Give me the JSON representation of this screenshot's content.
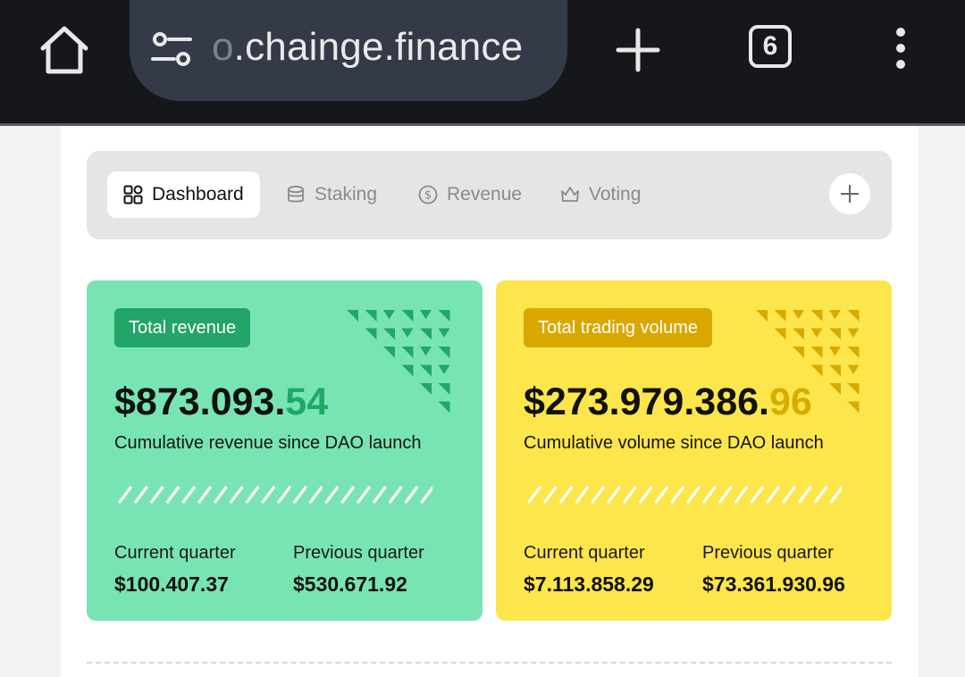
{
  "browser": {
    "url_faded": "o",
    "url_main": ".chainge.finance",
    "tab_count": "6"
  },
  "tabs": [
    {
      "label": "Dashboard",
      "icon": "grid-icon",
      "active": true
    },
    {
      "label": "Staking",
      "icon": "database-icon",
      "active": false
    },
    {
      "label": "Revenue",
      "icon": "dollar-circle-icon",
      "active": false
    },
    {
      "label": "Voting",
      "icon": "crown-icon",
      "active": false
    }
  ],
  "revenue_card": {
    "badge": "Total revenue",
    "amount_main": "$873.093.",
    "amount_cents": "54",
    "subtitle": "Cumulative revenue since DAO launch",
    "current_label": "Current quarter",
    "current_value": "$100.407.37",
    "previous_label": "Previous quarter",
    "previous_value": "$530.671.92",
    "color": "#78e4b4"
  },
  "volume_card": {
    "badge": "Total trading volume",
    "amount_main": "$273.979.386.",
    "amount_cents": "96",
    "subtitle": "Cumulative volume since DAO launch",
    "current_label": "Current quarter",
    "current_value": "$7.113.858.29",
    "previous_label": "Previous quarter",
    "previous_value": "$73.361.930.96",
    "color": "#fde54c"
  }
}
